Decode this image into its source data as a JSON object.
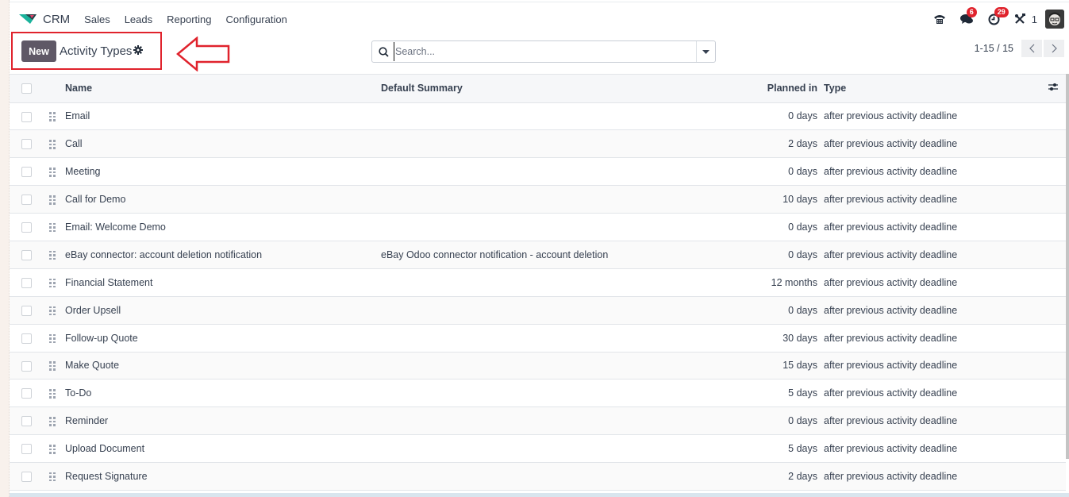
{
  "navbar": {
    "app_name": "CRM",
    "menu": [
      "Sales",
      "Leads",
      "Reporting",
      "Configuration"
    ],
    "systray": {
      "phone_icon": "phone-icon",
      "messages_badge": "6",
      "activities_badge": "29",
      "company_count": "1"
    }
  },
  "control_panel": {
    "new_label": "New",
    "breadcrumb": "Activity Types",
    "search_placeholder": "Search...",
    "pager": "1-15 / 15"
  },
  "accent_colors": {
    "primary_button": "#5f5866",
    "annotation_red": "#e0232d",
    "badge_red": "#e0232d"
  },
  "table": {
    "columns": [
      "Name",
      "Default Summary",
      "Planned in",
      "Type"
    ],
    "rows": [
      {
        "name": "Email",
        "summary": "",
        "planned": "0 days",
        "type": "after previous activity deadline"
      },
      {
        "name": "Call",
        "summary": "",
        "planned": "2 days",
        "type": "after previous activity deadline"
      },
      {
        "name": "Meeting",
        "summary": "",
        "planned": "0 days",
        "type": "after previous activity deadline"
      },
      {
        "name": "Call for Demo",
        "summary": "",
        "planned": "10 days",
        "type": "after previous activity deadline"
      },
      {
        "name": "Email: Welcome Demo",
        "summary": "",
        "planned": "0 days",
        "type": "after previous activity deadline"
      },
      {
        "name": "eBay connector: account deletion notification",
        "summary": "eBay Odoo connector notification - account deletion",
        "planned": "0 days",
        "type": "after previous activity deadline"
      },
      {
        "name": "Financial Statement",
        "summary": "",
        "planned": "12 months",
        "type": "after previous activity deadline"
      },
      {
        "name": "Order Upsell",
        "summary": "",
        "planned": "0 days",
        "type": "after previous activity deadline"
      },
      {
        "name": "Follow-up Quote",
        "summary": "",
        "planned": "30 days",
        "type": "after previous activity deadline"
      },
      {
        "name": "Make Quote",
        "summary": "",
        "planned": "15 days",
        "type": "after previous activity deadline"
      },
      {
        "name": "To-Do",
        "summary": "",
        "planned": "5 days",
        "type": "after previous activity deadline"
      },
      {
        "name": "Reminder",
        "summary": "",
        "planned": "0 days",
        "type": "after previous activity deadline"
      },
      {
        "name": "Upload Document",
        "summary": "",
        "planned": "5 days",
        "type": "after previous activity deadline"
      },
      {
        "name": "Request Signature",
        "summary": "",
        "planned": "2 days",
        "type": "after previous activity deadline"
      }
    ]
  }
}
